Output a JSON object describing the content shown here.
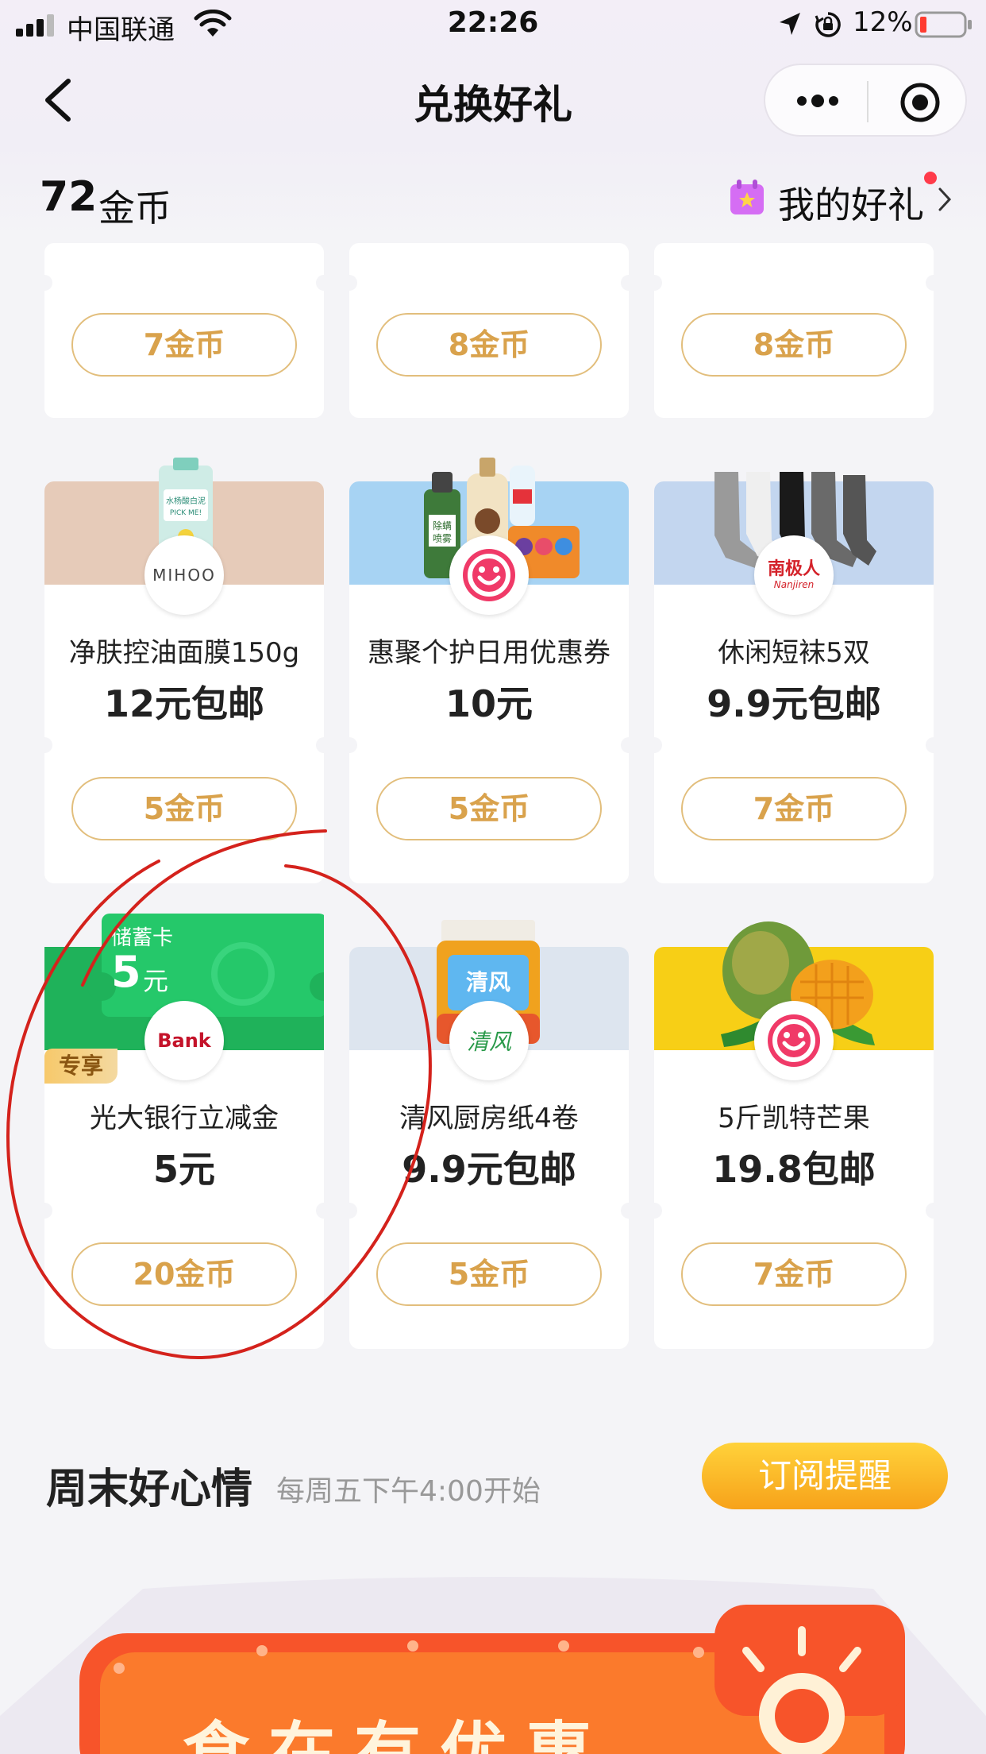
{
  "status_bar": {
    "carrier": "中国联通",
    "time": "22:26",
    "battery": "12%"
  },
  "nav": {
    "title": "兑换好礼"
  },
  "account": {
    "coins": "72",
    "coins_unit": "金币",
    "my_gifts_label": "我的好礼"
  },
  "products": [
    {
      "name": "",
      "price": "",
      "cost": "7金币"
    },
    {
      "name": "",
      "price": "",
      "cost": "8金币"
    },
    {
      "name": "",
      "price": "",
      "cost": "8金币"
    },
    {
      "name": "净肤控油面膜150g",
      "price": "12元包邮",
      "cost": "5金币",
      "brand": "MIHOO",
      "product_text": "水杨酸白泥 PICK ME!"
    },
    {
      "name": "惠聚个护日用优惠券",
      "price": "10元",
      "cost": "5金币",
      "product_text": "除螨喷雾"
    },
    {
      "name": "休闲短袜5双",
      "price": "9.9元包邮",
      "cost": "7金币",
      "brand": "南极人",
      "brand_sub": "Nanjiren"
    },
    {
      "name": "光大银行立减金",
      "price": "5元",
      "cost": "20金币",
      "tag": "专享",
      "card_type": "储蓄卡",
      "card_amount": "5",
      "card_unit": "元",
      "brand": "Bank"
    },
    {
      "name": "清风厨房纸4卷",
      "price": "9.9元包邮",
      "cost": "5金币",
      "brand": "清风",
      "product_text": "清风"
    },
    {
      "name": "5斤凯特芒果",
      "price": "19.8包邮",
      "cost": "7金币"
    }
  ],
  "weekend": {
    "title": "周末好心情",
    "subtitle": "每周五下午4:00开始",
    "subscribe_label": "订阅提醒",
    "banner_text": "食在有优惠"
  },
  "colors": {
    "accent_gold": "#d9a24c",
    "button_border": "#e2be7c",
    "subscribe_start": "#ffd23a",
    "subscribe_end": "#f7a21a",
    "annotation_red": "#d4221c"
  }
}
